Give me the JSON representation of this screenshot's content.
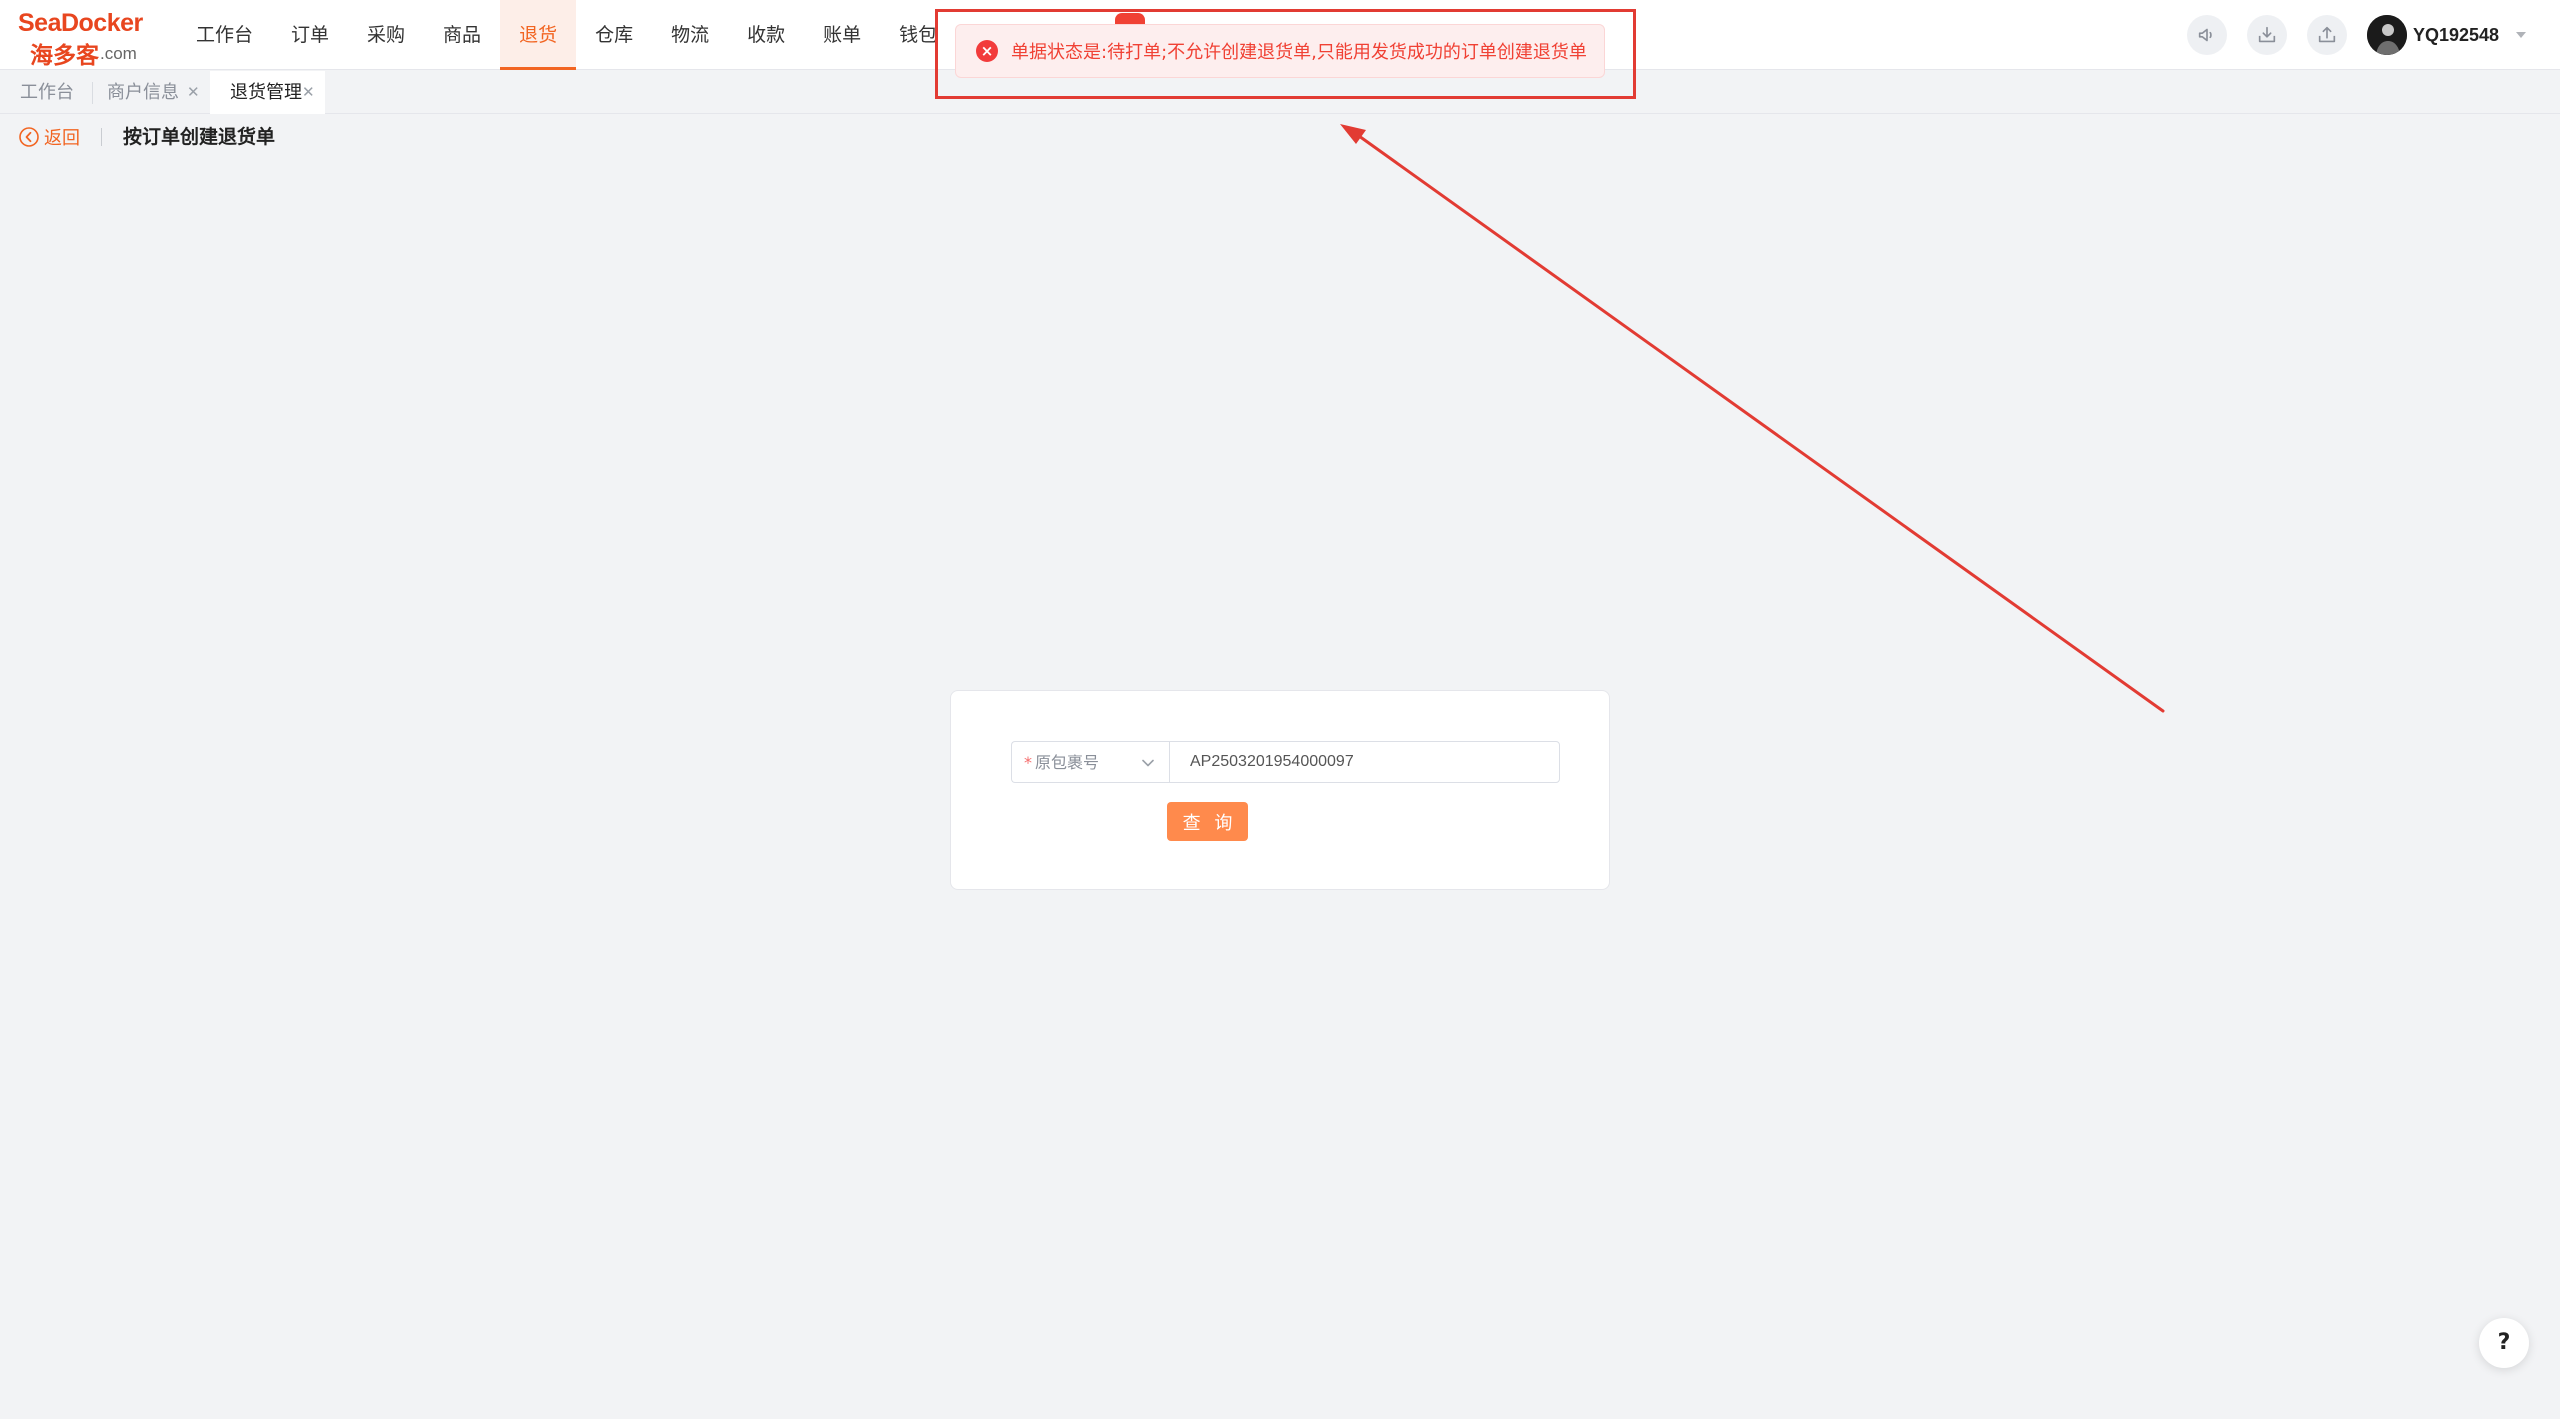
{
  "brand": {
    "logo_en": "SeaDocker",
    "logo_cn": "海多客",
    "logo_domain": ".com"
  },
  "nav": {
    "items": [
      {
        "label": "工作台",
        "active": false
      },
      {
        "label": "订单",
        "active": false
      },
      {
        "label": "采购",
        "active": false
      },
      {
        "label": "商品",
        "active": false
      },
      {
        "label": "退货",
        "active": true
      },
      {
        "label": "仓库",
        "active": false
      },
      {
        "label": "物流",
        "active": false
      },
      {
        "label": "收款",
        "active": false
      },
      {
        "label": "账单",
        "active": false
      },
      {
        "label": "钱包",
        "active": false
      }
    ]
  },
  "header_tools": {
    "icons": [
      "announcement-icon",
      "download-icon",
      "export-icon"
    ],
    "username": "YQ192548"
  },
  "tabs": [
    {
      "label": "工作台",
      "active": false,
      "closable": false
    },
    {
      "label": "商户信息",
      "active": false,
      "closable": true
    },
    {
      "label": "退货管理",
      "active": true,
      "closable": true
    }
  ],
  "page": {
    "back_label": "返回",
    "title": "按订单创建退货单"
  },
  "toast": {
    "type": "error",
    "message": "单据状态是:待打单;不允许创建退货单,只能用发货成功的订单创建退货单"
  },
  "search_form": {
    "select_value": "原包裹号",
    "input_value": "AP2503201954000097",
    "query_button": "查 询"
  },
  "help_button": "?",
  "colors": {
    "accent": "#f26522",
    "error": "#f04134",
    "annotation": "#e23b33",
    "button": "#ff8a4c"
  }
}
